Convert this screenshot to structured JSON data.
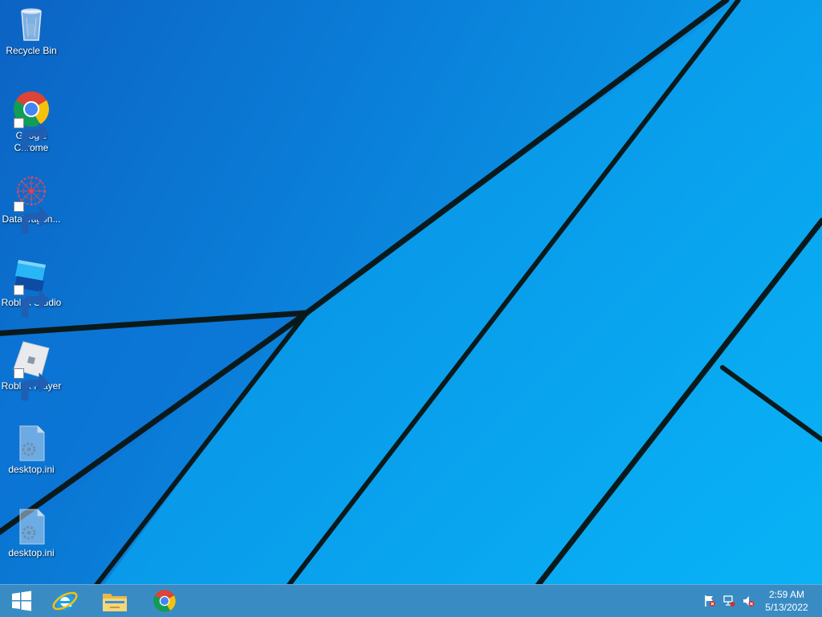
{
  "desktop": {
    "icons": [
      {
        "label": "Recycle Bin",
        "icon": "recycle-bin-icon"
      },
      {
        "label": "Google Chrome",
        "icon": "chrome-icon"
      },
      {
        "label": "DataWagon...",
        "icon": "datawagon-icon"
      },
      {
        "label": "Roblox Studio",
        "icon": "roblox-studio-icon"
      },
      {
        "label": "Roblox Player",
        "icon": "roblox-player-icon"
      },
      {
        "label": "desktop.ini",
        "icon": "settings-file-icon"
      },
      {
        "label": "desktop.ini",
        "icon": "settings-file-icon"
      }
    ]
  },
  "taskbar": {
    "pinned": [
      {
        "name": "Start",
        "icon": "windows-logo-icon"
      },
      {
        "name": "Internet Explorer",
        "icon": "internet-explorer-icon"
      },
      {
        "name": "File Explorer",
        "icon": "file-explorer-icon"
      },
      {
        "name": "Google Chrome",
        "icon": "chrome-icon"
      }
    ],
    "tray": {
      "icons": [
        "action-center-flag-icon",
        "network-icon",
        "volume-muted-icon"
      ],
      "time": "2:59 AM",
      "date": "5/13/2022"
    }
  },
  "colors": {
    "wallpaper_blue": "#0a8ee6",
    "wallpaper_lines": "#06151a",
    "taskbar": "#2882be"
  }
}
